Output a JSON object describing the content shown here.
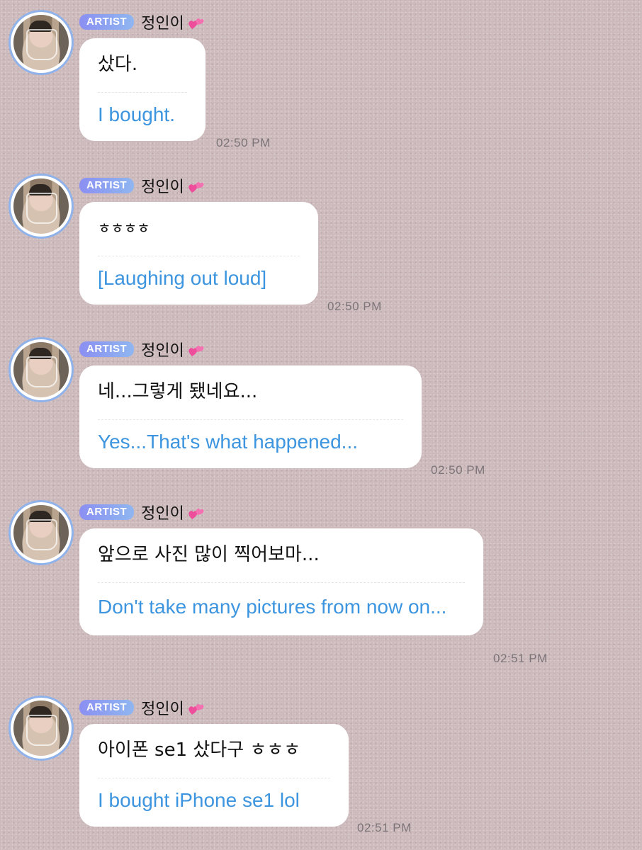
{
  "colors": {
    "accent_blue": "#3c95de",
    "badge_start": "#8b8ff2",
    "badge_end": "#8fb6f0",
    "avatar_ring": "#8fb2ea"
  },
  "messages": [
    {
      "badge": "ARTIST",
      "name": "정인이",
      "korean": "샀다.",
      "english": "I bought.",
      "time": "02:50 PM"
    },
    {
      "badge": "ARTIST",
      "name": "정인이",
      "korean": "ㅎㅎㅎㅎ",
      "english": "[Laughing out loud]",
      "time": "02:50 PM"
    },
    {
      "badge": "ARTIST",
      "name": "정인이",
      "korean": "네...그렇게 됐네요...",
      "english": "Yes...That's what happened...",
      "time": "02:50 PM"
    },
    {
      "badge": "ARTIST",
      "name": "정인이",
      "korean": "앞으로 사진 많이 찍어보마...",
      "english": "Don't take many pictures from now on...",
      "time": "02:51 PM"
    },
    {
      "badge": "ARTIST",
      "name": "정인이",
      "korean": "아이폰 se1 샀다구 ㅎㅎㅎ",
      "english": "I bought iPhone se1 lol",
      "time": "02:51 PM"
    }
  ]
}
